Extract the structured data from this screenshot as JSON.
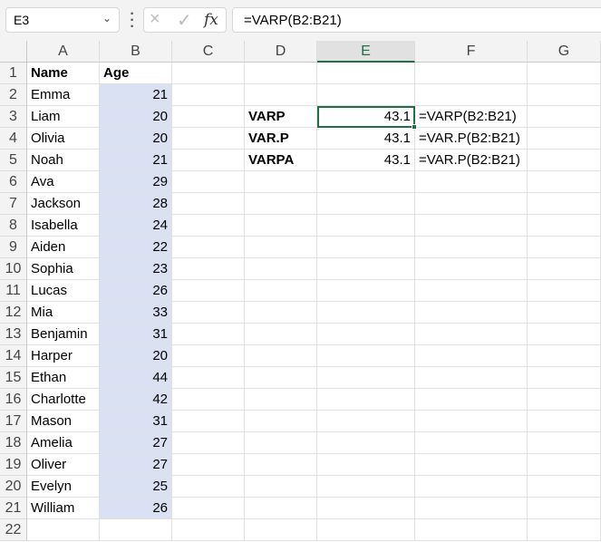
{
  "name_box": "E3",
  "formula_bar": "=VARP(B2:B21)",
  "icons": {
    "cancel": "×",
    "confirm": "✓",
    "fx": "fx",
    "dropdown": "⌄"
  },
  "columns": [
    "A",
    "B",
    "C",
    "D",
    "E",
    "F",
    "G"
  ],
  "selected_column": "E",
  "rows": [
    "1",
    "2",
    "3",
    "4",
    "5",
    "6",
    "7",
    "8",
    "9",
    "10",
    "11",
    "12",
    "13",
    "14",
    "15",
    "16",
    "17",
    "18",
    "19",
    "20",
    "21",
    "22"
  ],
  "headers": {
    "name": "Name",
    "age": "Age"
  },
  "people": [
    {
      "name": "Emma",
      "age": "21"
    },
    {
      "name": "Liam",
      "age": "20"
    },
    {
      "name": "Olivia",
      "age": "20"
    },
    {
      "name": "Noah",
      "age": "21"
    },
    {
      "name": "Ava",
      "age": "29"
    },
    {
      "name": "Jackson",
      "age": "28"
    },
    {
      "name": "Isabella",
      "age": "24"
    },
    {
      "name": "Aiden",
      "age": "22"
    },
    {
      "name": "Sophia",
      "age": "23"
    },
    {
      "name": "Lucas",
      "age": "26"
    },
    {
      "name": "Mia",
      "age": "33"
    },
    {
      "name": "Benjamin",
      "age": "31"
    },
    {
      "name": "Harper",
      "age": "20"
    },
    {
      "name": "Ethan",
      "age": "44"
    },
    {
      "name": "Charlotte",
      "age": "42"
    },
    {
      "name": "Mason",
      "age": "31"
    },
    {
      "name": "Amelia",
      "age": "27"
    },
    {
      "name": "Oliver",
      "age": "27"
    },
    {
      "name": "Evelyn",
      "age": "25"
    },
    {
      "name": "William",
      "age": "26"
    }
  ],
  "results": [
    {
      "label": "VARP",
      "value": "43.1",
      "formula": "=VARP(B2:B21)"
    },
    {
      "label": "VAR.P",
      "value": "43.1",
      "formula": "=VAR.P(B2:B21)"
    },
    {
      "label": "VARPA",
      "value": "43.1",
      "formula": "=VAR.P(B2:B21)"
    }
  ],
  "colors": {
    "accent": "#1e7145",
    "highlight": "#dae1f3"
  }
}
